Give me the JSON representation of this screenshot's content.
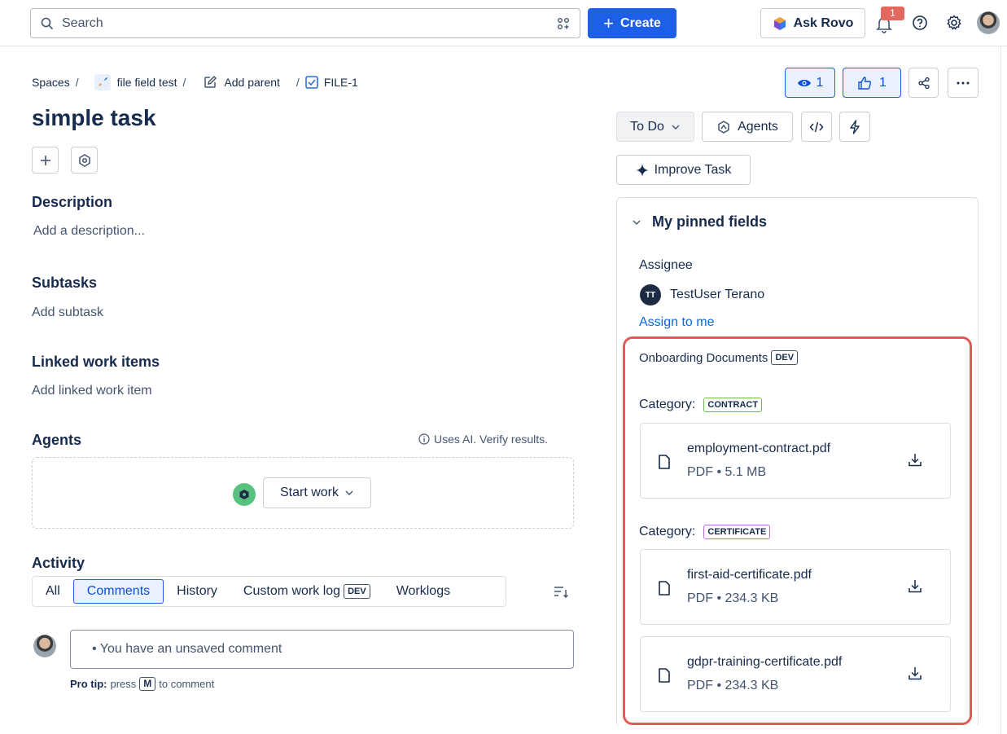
{
  "topbar": {
    "search_placeholder": "Search",
    "create_label": "Create",
    "ask_rovo_label": "Ask Rovo",
    "notification_count": "1"
  },
  "breadcrumb": {
    "spaces": "Spaces",
    "project": "file field test",
    "add_parent": "Add parent",
    "issue_key": "FILE-1"
  },
  "issue": {
    "title": "simple task"
  },
  "description": {
    "heading": "Description",
    "placeholder": "Add a description..."
  },
  "subtasks": {
    "heading": "Subtasks",
    "action": "Add subtask"
  },
  "linked": {
    "heading": "Linked work items",
    "action": "Add linked work item"
  },
  "agents": {
    "heading": "Agents",
    "ai_note": "Uses AI. Verify results.",
    "start_work": "Start work"
  },
  "activity": {
    "heading": "Activity",
    "tabs": [
      "All",
      "Comments",
      "History",
      "Custom work log",
      "Worklogs"
    ],
    "active_tab": "Comments",
    "dev_tag": "DEV",
    "comment_placeholder": "• You have an unsaved comment",
    "pro_tip_label": "Pro tip:",
    "pro_tip_press": "press",
    "pro_tip_key": "M",
    "pro_tip_rest": "to comment"
  },
  "right": {
    "watch_count": "1",
    "like_count": "1",
    "status": "To Do",
    "agents_btn": "Agents",
    "improve_task": "Improve Task"
  },
  "pinned": {
    "heading": "My pinned fields",
    "assignee_label": "Assignee",
    "assignee_initials": "TT",
    "assignee_name": "TestUser Terano",
    "assign_to_me": "Assign to me",
    "onboarding_title": "Onboarding Documents",
    "onboarding_tag": "DEV",
    "category_label": "Category:",
    "groups": [
      {
        "category": "CONTRACT",
        "files": [
          {
            "name": "employment-contract.pdf",
            "meta": "PDF • 5.1 MB"
          }
        ]
      },
      {
        "category": "CERTIFICATE",
        "files": [
          {
            "name": "first-aid-certificate.pdf",
            "meta": "PDF • 234.3 KB"
          },
          {
            "name": "gdpr-training-certificate.pdf",
            "meta": "PDF • 234.3 KB"
          }
        ]
      }
    ]
  },
  "colors": {
    "brand_blue": "#1d5fe6",
    "highlight_red": "#e25a55",
    "contract_green": "#6cc04a",
    "certificate_purple": "#c56ae3"
  }
}
